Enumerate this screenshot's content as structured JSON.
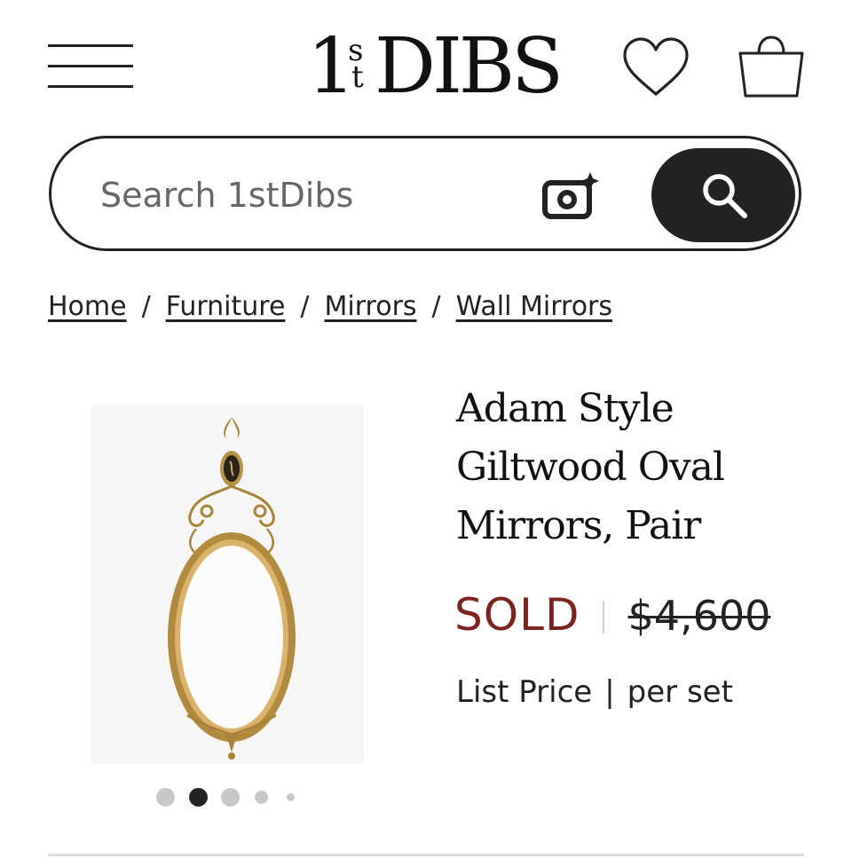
{
  "header": {
    "logo": {
      "one": "1",
      "st_top": "s",
      "st_bottom": "t",
      "word": "DIBS"
    },
    "icons": {
      "menu": "hamburger-menu-icon",
      "favorites": "heart-icon",
      "cart": "shopping-bag-icon"
    }
  },
  "search": {
    "placeholder": "Search 1stDibs",
    "value": "",
    "icons": {
      "visual_search": "camera-sparkle-icon",
      "submit": "search-icon"
    }
  },
  "breadcrumb": [
    {
      "label": "Home"
    },
    {
      "label": "Furniture"
    },
    {
      "label": "Mirrors"
    },
    {
      "label": "Wall Mirrors"
    }
  ],
  "breadcrumb_separator": "/",
  "product": {
    "title_lines": [
      "Adam Style",
      "Giltwood Oval",
      "Mirrors, Pair"
    ],
    "status": "SOLD",
    "original_price": "$4,600",
    "list_price_label": "List Price",
    "price_sep": "|",
    "price_unit": "per set",
    "gallery": {
      "slide_count": 5,
      "active_index": 1
    }
  },
  "colors": {
    "sold": "#7b2420",
    "primary": "#222222",
    "divider": "#dddddd"
  }
}
